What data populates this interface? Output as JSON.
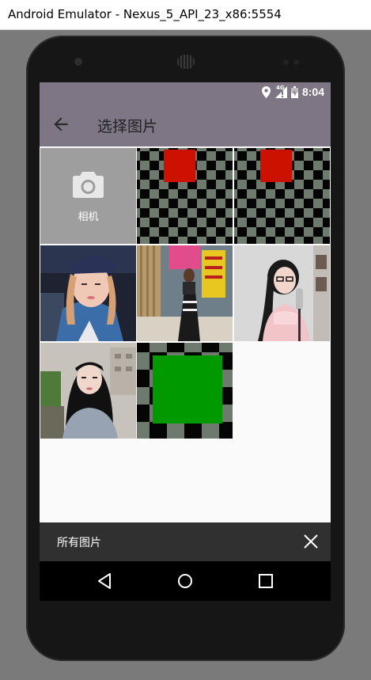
{
  "window": {
    "title": "Android Emulator - Nexus_5_API_23_x86:5554"
  },
  "status_bar": {
    "time": "8:04",
    "network": "4G"
  },
  "app_bar": {
    "title": "选择图片",
    "back_icon": "arrow-back-icon"
  },
  "grid": {
    "camera_tile": {
      "label": "相机",
      "icon": "camera-icon"
    },
    "images": [
      {
        "name": "checker-red-1"
      },
      {
        "name": "checker-red-2"
      },
      {
        "name": "photo-girl-cap"
      },
      {
        "name": "photo-street"
      },
      {
        "name": "photo-girl-mic"
      },
      {
        "name": "photo-girl-outdoor"
      },
      {
        "name": "checker-green"
      }
    ]
  },
  "bottom_bar": {
    "label": "所有图片",
    "close_icon": "close-icon"
  },
  "nav_bar": {
    "icons": [
      "back-triangle-icon",
      "home-circle-icon",
      "recents-square-icon"
    ]
  },
  "colors": {
    "app_bar": "#7f7685",
    "bottom_bar": "#303030",
    "camera_tile": "#9e9e9e",
    "red_block": "#cc1100",
    "green_block": "#009a00"
  }
}
